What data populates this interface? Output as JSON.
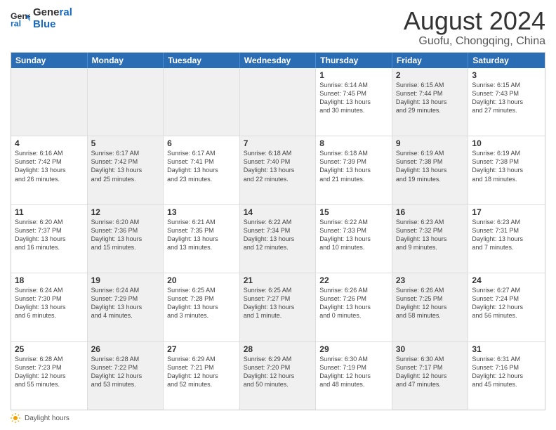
{
  "header": {
    "logo_line1": "General",
    "logo_line2": "Blue",
    "main_title": "August 2024",
    "subtitle": "Guofu, Chongqing, China"
  },
  "weekdays": [
    "Sunday",
    "Monday",
    "Tuesday",
    "Wednesday",
    "Thursday",
    "Friday",
    "Saturday"
  ],
  "weeks": [
    [
      {
        "day": "",
        "info": "",
        "shaded": true
      },
      {
        "day": "",
        "info": "",
        "shaded": true
      },
      {
        "day": "",
        "info": "",
        "shaded": true
      },
      {
        "day": "",
        "info": "",
        "shaded": true
      },
      {
        "day": "1",
        "info": "Sunrise: 6:14 AM\nSunset: 7:45 PM\nDaylight: 13 hours\nand 30 minutes.",
        "shaded": false
      },
      {
        "day": "2",
        "info": "Sunrise: 6:15 AM\nSunset: 7:44 PM\nDaylight: 13 hours\nand 29 minutes.",
        "shaded": true
      },
      {
        "day": "3",
        "info": "Sunrise: 6:15 AM\nSunset: 7:43 PM\nDaylight: 13 hours\nand 27 minutes.",
        "shaded": false
      }
    ],
    [
      {
        "day": "4",
        "info": "Sunrise: 6:16 AM\nSunset: 7:42 PM\nDaylight: 13 hours\nand 26 minutes.",
        "shaded": false
      },
      {
        "day": "5",
        "info": "Sunrise: 6:17 AM\nSunset: 7:42 PM\nDaylight: 13 hours\nand 25 minutes.",
        "shaded": true
      },
      {
        "day": "6",
        "info": "Sunrise: 6:17 AM\nSunset: 7:41 PM\nDaylight: 13 hours\nand 23 minutes.",
        "shaded": false
      },
      {
        "day": "7",
        "info": "Sunrise: 6:18 AM\nSunset: 7:40 PM\nDaylight: 13 hours\nand 22 minutes.",
        "shaded": true
      },
      {
        "day": "8",
        "info": "Sunrise: 6:18 AM\nSunset: 7:39 PM\nDaylight: 13 hours\nand 21 minutes.",
        "shaded": false
      },
      {
        "day": "9",
        "info": "Sunrise: 6:19 AM\nSunset: 7:38 PM\nDaylight: 13 hours\nand 19 minutes.",
        "shaded": true
      },
      {
        "day": "10",
        "info": "Sunrise: 6:19 AM\nSunset: 7:38 PM\nDaylight: 13 hours\nand 18 minutes.",
        "shaded": false
      }
    ],
    [
      {
        "day": "11",
        "info": "Sunrise: 6:20 AM\nSunset: 7:37 PM\nDaylight: 13 hours\nand 16 minutes.",
        "shaded": false
      },
      {
        "day": "12",
        "info": "Sunrise: 6:20 AM\nSunset: 7:36 PM\nDaylight: 13 hours\nand 15 minutes.",
        "shaded": true
      },
      {
        "day": "13",
        "info": "Sunrise: 6:21 AM\nSunset: 7:35 PM\nDaylight: 13 hours\nand 13 minutes.",
        "shaded": false
      },
      {
        "day": "14",
        "info": "Sunrise: 6:22 AM\nSunset: 7:34 PM\nDaylight: 13 hours\nand 12 minutes.",
        "shaded": true
      },
      {
        "day": "15",
        "info": "Sunrise: 6:22 AM\nSunset: 7:33 PM\nDaylight: 13 hours\nand 10 minutes.",
        "shaded": false
      },
      {
        "day": "16",
        "info": "Sunrise: 6:23 AM\nSunset: 7:32 PM\nDaylight: 13 hours\nand 9 minutes.",
        "shaded": true
      },
      {
        "day": "17",
        "info": "Sunrise: 6:23 AM\nSunset: 7:31 PM\nDaylight: 13 hours\nand 7 minutes.",
        "shaded": false
      }
    ],
    [
      {
        "day": "18",
        "info": "Sunrise: 6:24 AM\nSunset: 7:30 PM\nDaylight: 13 hours\nand 6 minutes.",
        "shaded": false
      },
      {
        "day": "19",
        "info": "Sunrise: 6:24 AM\nSunset: 7:29 PM\nDaylight: 13 hours\nand 4 minutes.",
        "shaded": true
      },
      {
        "day": "20",
        "info": "Sunrise: 6:25 AM\nSunset: 7:28 PM\nDaylight: 13 hours\nand 3 minutes.",
        "shaded": false
      },
      {
        "day": "21",
        "info": "Sunrise: 6:25 AM\nSunset: 7:27 PM\nDaylight: 13 hours\nand 1 minute.",
        "shaded": true
      },
      {
        "day": "22",
        "info": "Sunrise: 6:26 AM\nSunset: 7:26 PM\nDaylight: 13 hours\nand 0 minutes.",
        "shaded": false
      },
      {
        "day": "23",
        "info": "Sunrise: 6:26 AM\nSunset: 7:25 PM\nDaylight: 12 hours\nand 58 minutes.",
        "shaded": true
      },
      {
        "day": "24",
        "info": "Sunrise: 6:27 AM\nSunset: 7:24 PM\nDaylight: 12 hours\nand 56 minutes.",
        "shaded": false
      }
    ],
    [
      {
        "day": "25",
        "info": "Sunrise: 6:28 AM\nSunset: 7:23 PM\nDaylight: 12 hours\nand 55 minutes.",
        "shaded": false
      },
      {
        "day": "26",
        "info": "Sunrise: 6:28 AM\nSunset: 7:22 PM\nDaylight: 12 hours\nand 53 minutes.",
        "shaded": true
      },
      {
        "day": "27",
        "info": "Sunrise: 6:29 AM\nSunset: 7:21 PM\nDaylight: 12 hours\nand 52 minutes.",
        "shaded": false
      },
      {
        "day": "28",
        "info": "Sunrise: 6:29 AM\nSunset: 7:20 PM\nDaylight: 12 hours\nand 50 minutes.",
        "shaded": true
      },
      {
        "day": "29",
        "info": "Sunrise: 6:30 AM\nSunset: 7:19 PM\nDaylight: 12 hours\nand 48 minutes.",
        "shaded": false
      },
      {
        "day": "30",
        "info": "Sunrise: 6:30 AM\nSunset: 7:17 PM\nDaylight: 12 hours\nand 47 minutes.",
        "shaded": true
      },
      {
        "day": "31",
        "info": "Sunrise: 6:31 AM\nSunset: 7:16 PM\nDaylight: 12 hours\nand 45 minutes.",
        "shaded": false
      }
    ]
  ],
  "footer": {
    "note": "Daylight hours"
  }
}
